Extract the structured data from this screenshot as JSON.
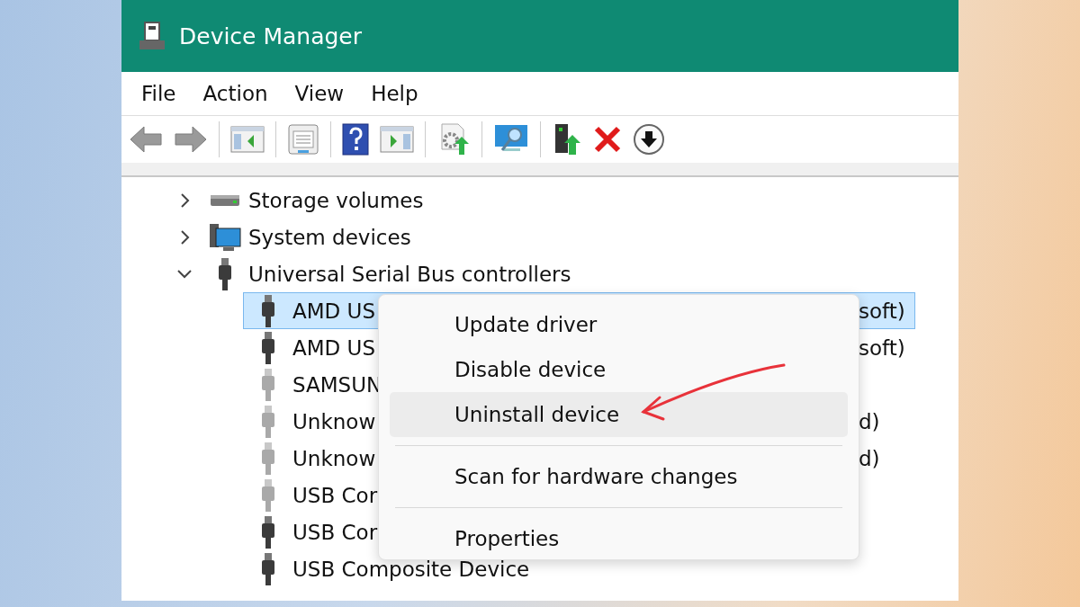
{
  "window": {
    "title": "Device Manager"
  },
  "menu_bar": [
    "File",
    "Action",
    "View",
    "Help"
  ],
  "toolbar": [
    {
      "kind": "back"
    },
    {
      "kind": "forward"
    },
    {
      "kind": "separator"
    },
    {
      "kind": "console-tree"
    },
    {
      "kind": "separator"
    },
    {
      "kind": "properties"
    },
    {
      "kind": "separator"
    },
    {
      "kind": "help"
    },
    {
      "kind": "action-pane"
    },
    {
      "kind": "separator"
    },
    {
      "kind": "update-driver"
    },
    {
      "kind": "separator"
    },
    {
      "kind": "scan"
    },
    {
      "kind": "separator"
    },
    {
      "kind": "enable"
    },
    {
      "kind": "uninstall"
    },
    {
      "kind": "disable"
    }
  ],
  "tree": [
    {
      "label": "Storage volumes",
      "kind": "storage",
      "expanded": false
    },
    {
      "label": "System devices",
      "kind": "system",
      "expanded": false
    },
    {
      "label": "Universal Serial Bus controllers",
      "kind": "usb",
      "expanded": true,
      "children": [
        {
          "label": "AMD US",
          "tail": "soft)",
          "disabled": false,
          "selected": true
        },
        {
          "label": "AMD US",
          "tail": "soft)",
          "disabled": false,
          "selected": false
        },
        {
          "label": "SAMSUN",
          "disabled": true,
          "selected": false
        },
        {
          "label": "Unknow",
          "tail": "d)",
          "disabled": true,
          "selected": false
        },
        {
          "label": "Unknow",
          "tail": "d)",
          "disabled": true,
          "selected": false
        },
        {
          "label": "USB Cor",
          "disabled": true,
          "selected": false
        },
        {
          "label": "USB Cor",
          "disabled": false,
          "selected": false
        },
        {
          "label": "USB Composite Device",
          "disabled": false,
          "selected": false
        }
      ]
    }
  ],
  "context_menu": [
    {
      "kind": "item",
      "label": "Update driver",
      "selected": false
    },
    {
      "kind": "item",
      "label": "Disable device",
      "selected": false
    },
    {
      "kind": "item",
      "label": "Uninstall device",
      "selected": true
    },
    {
      "kind": "separator"
    },
    {
      "kind": "item",
      "label": "Scan for hardware changes",
      "selected": false
    },
    {
      "kind": "separator"
    },
    {
      "kind": "item",
      "label": "Properties",
      "selected": false
    }
  ]
}
